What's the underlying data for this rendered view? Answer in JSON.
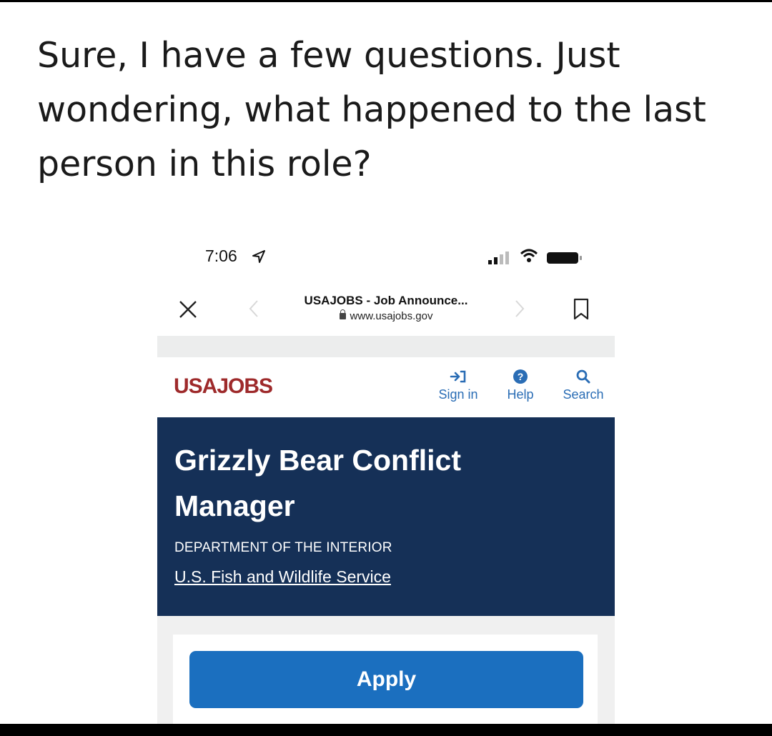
{
  "tweet": {
    "text": "Sure, I have a few questions. Just wondering, what happened to the last person in this role?"
  },
  "status_bar": {
    "time": "7:06",
    "icons": [
      "location-arrow-icon",
      "signal-icon",
      "wifi-icon",
      "battery-icon"
    ]
  },
  "browser": {
    "page_title": "USAJOBS - Job Announce...",
    "host": "www.usajobs.gov",
    "icons": [
      "close-icon",
      "back-icon",
      "forward-icon",
      "bookmark-icon",
      "lock-icon"
    ]
  },
  "site": {
    "logo": "USAJOBS",
    "nav": [
      {
        "label": "Sign in",
        "icon": "sign-in-icon"
      },
      {
        "label": "Help",
        "icon": "help-icon"
      },
      {
        "label": "Search",
        "icon": "search-icon"
      }
    ],
    "job": {
      "title": "Grizzly Bear Conflict Manager",
      "department": "DEPARTMENT OF THE INTERIOR",
      "agency": "U.S. Fish and Wildlife Service"
    },
    "apply_label": "Apply"
  },
  "colors": {
    "logo": "#9e2a2b",
    "hero": "#153057",
    "link": "#2a6db5",
    "apply_button": "#1b6fbf"
  }
}
